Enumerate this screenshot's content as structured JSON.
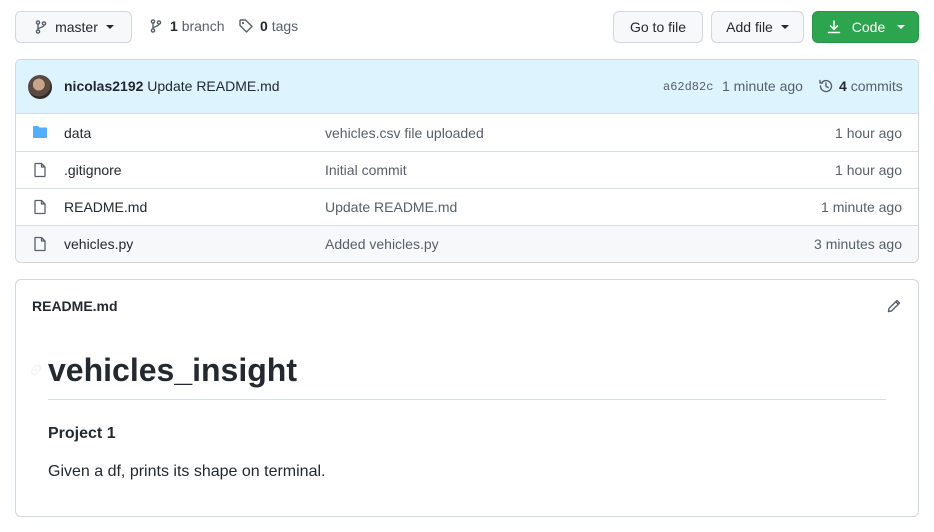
{
  "toolbar": {
    "branch_name": "master",
    "branch_count": "1",
    "branch_label": "branch",
    "tag_count": "0",
    "tag_label": "tags",
    "go_to_file": "Go to file",
    "add_file": "Add file",
    "code": "Code"
  },
  "commit": {
    "author": "nicolas2192",
    "message": "Update README.md",
    "sha": "a62d82c",
    "time": "1 minute ago",
    "count": "4",
    "count_label": "commits"
  },
  "files": [
    {
      "name": "data",
      "type": "folder",
      "message": "vehicles.csv file uploaded",
      "age": "1 hour ago"
    },
    {
      "name": ".gitignore",
      "type": "file",
      "message": "Initial commit",
      "age": "1 hour ago"
    },
    {
      "name": "README.md",
      "type": "file",
      "message": "Update README.md",
      "age": "1 minute ago"
    },
    {
      "name": "vehicles.py",
      "type": "file",
      "message": "Added vehicles.py",
      "age": "3 minutes ago"
    }
  ],
  "readme": {
    "filename": "README.md",
    "heading": "vehicles_insight",
    "subheading": "Project 1",
    "paragraph": "Given a df, prints its shape on terminal."
  },
  "colors": {
    "code_button": "#2da44e",
    "folder_icon": "#54aeff",
    "commit_bar": "#ddf4ff"
  }
}
